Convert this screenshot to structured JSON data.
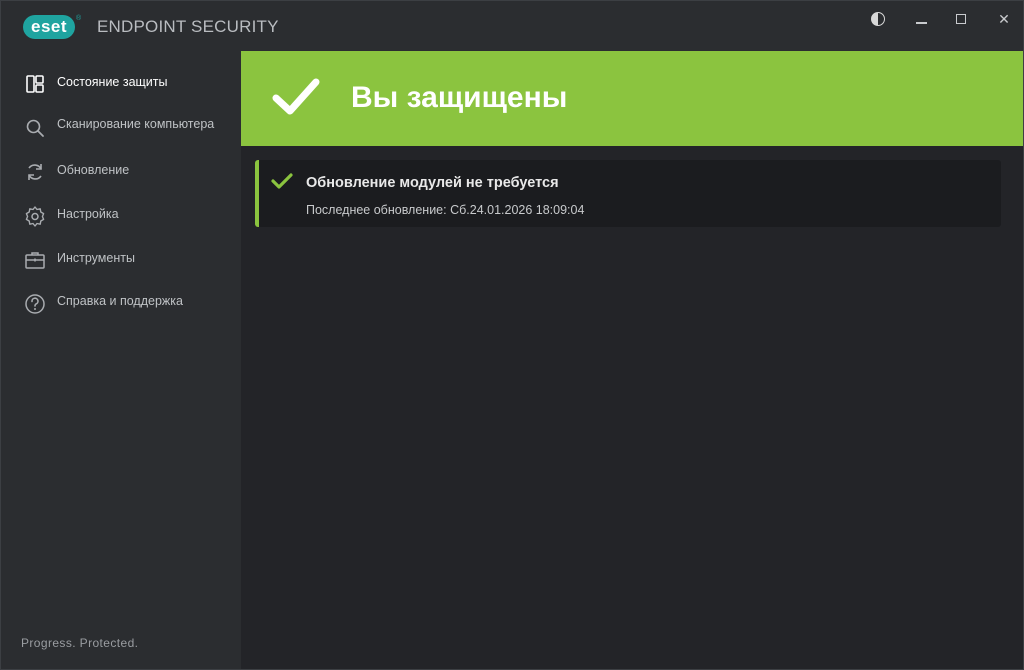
{
  "app": {
    "logo_text": "eset",
    "logo_reg": "®",
    "product_name": "ENDPOINT SECURITY"
  },
  "window_controls": {
    "theme": "contrast-icon",
    "minimize": "minimize-icon",
    "maximize": "maximize-icon",
    "close": "✕"
  },
  "sidebar": {
    "items": [
      {
        "label": "Состояние защиты",
        "icon": "dashboard-icon",
        "active": true
      },
      {
        "label": "Сканирование компьютера",
        "icon": "search-icon",
        "active": false
      },
      {
        "label": "Обновление",
        "icon": "refresh-icon",
        "active": false
      },
      {
        "label": "Настройка",
        "icon": "gear-icon",
        "active": false
      },
      {
        "label": "Инструменты",
        "icon": "toolbox-icon",
        "active": false
      },
      {
        "label": "Справка и поддержка",
        "icon": "help-icon",
        "active": false
      }
    ],
    "footer": "Progress. Protected."
  },
  "main": {
    "banner_title": "Вы защищены",
    "status_card": {
      "title": "Обновление модулей не требуется",
      "subtitle": "Последнее обновление: Сб.24.01.2026 18:09:04"
    }
  },
  "colors": {
    "accent_green": "#8bc43f",
    "brand_teal": "#1fa4a0",
    "sidebar_bg": "#2b2d30",
    "main_bg": "#232428"
  }
}
